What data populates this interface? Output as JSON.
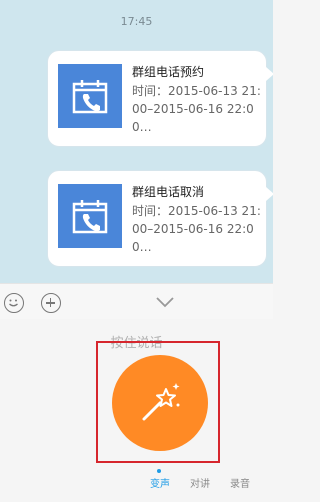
{
  "chat": {
    "timestamp": "17:45",
    "messages": [
      {
        "title": "群组电话预约",
        "body": "时间：2015-06-13 21:00–2015-06-16 22:00…",
        "icon": "calendar-phone-icon"
      },
      {
        "title": "群组电话取消",
        "body": "时间：2015-06-13 21:00–2015-06-16 22:00…",
        "icon": "calendar-phone-icon"
      }
    ]
  },
  "toolbar": {
    "icons": [
      "smiley-icon",
      "plus-circle-icon",
      "chevron-down-icon"
    ]
  },
  "voice_panel": {
    "hint": "按住说话",
    "mic_button_icon": "magic-wand-icon",
    "tabs": [
      {
        "label": "变声",
        "active": true
      },
      {
        "label": "对讲",
        "active": false
      },
      {
        "label": "录音",
        "active": false
      }
    ]
  },
  "colors": {
    "accent": "#ff8a25",
    "highlight": "#d6262d",
    "active_tab": "#1e9ce6",
    "card_icon_bg": "#4a86d9"
  }
}
